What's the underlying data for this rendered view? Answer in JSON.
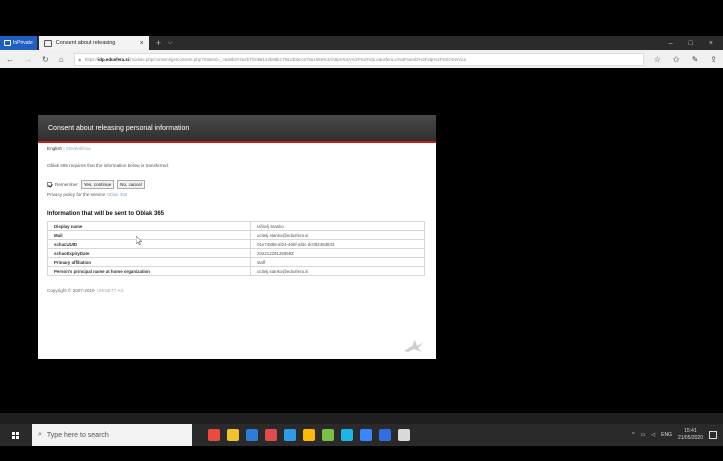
{
  "browser": {
    "inprivate_label": "InPrivate",
    "tab_title": "Consent about releasing",
    "url_scheme": "https://",
    "url_host": "idp.edusfera.si",
    "url_rest": "/module.php/consent/getconsent.php?StateId=_c5a9b374a2b7f1086143b88b179a23b5cc678a1556%3Ahttps%3A%2F%2Fidp.edusfera.si%2Fsaml2%2Fidp%2FSSOService",
    "window_controls": [
      "–",
      "□",
      "×"
    ]
  },
  "page": {
    "title": "Consent about releasing personal information",
    "lang_current": "English",
    "lang_other": "Slovenščina",
    "intro": "Oblak 365 requires that the information below is transferred.",
    "remember_label": "Remember",
    "yes_button": "Yes, continue",
    "no_button": "No, cancel",
    "privacy_text": "Privacy policy for the service",
    "privacy_link": "Oblak 365",
    "info_heading": "Information that will be sent to Oblak 365",
    "attributes": [
      {
        "name": "Display name",
        "value": "Učitelj Stanko"
      },
      {
        "name": "Mail",
        "value": "ucitelj.stanko@edusfera.si"
      },
      {
        "name": "schacUUID",
        "value": "01e74886-af24-46bf-afdc-dc08245d833"
      },
      {
        "name": "schacExpiryDate",
        "value": "20221229125959Z"
      },
      {
        "name": "Primary affiliation",
        "value": "staff"
      },
      {
        "name": "Person's principal name at home organization",
        "value": "ucitelj.stanko@edusfera.si"
      }
    ],
    "copyright": "Copyright © 2007-2019",
    "copyright_org": "UNINETT AS"
  },
  "taskbar": {
    "search_placeholder": "Type here to search",
    "language": "ENG",
    "time": "15:41",
    "date": "21/05/2020",
    "app_colors": [
      "#e94b3c",
      "#f2c12e",
      "#2d7cd6",
      "#e24b4b",
      "#2f9be8",
      "#ffb900",
      "#7ac043",
      "#1db4e8",
      "#3a86ff",
      "#2f6fe4",
      "#d9d9d9"
    ]
  },
  "colors": {
    "accent_red": "#c81d1d",
    "link": "#8aa8c8",
    "inprivate_blue": "#1f5fbf"
  }
}
